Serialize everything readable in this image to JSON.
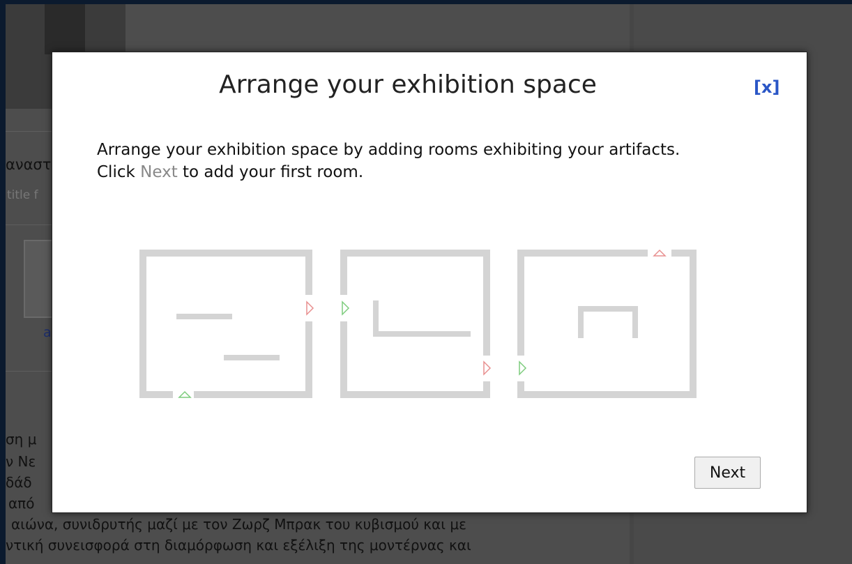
{
  "background": {
    "snippets": [
      "αναστ",
      "title f",
      "a",
      "ση μ",
      "ν Νε",
      "δάδ",
      "από",
      "αιώνα, συνιδρυτής μαζί με τον Ζωρζ Μπρακ του κυβισμού και με",
      "ντική συνεισφορά στη διαμόρφωση και εξέλιξη της μοντέρνας και"
    ]
  },
  "modal": {
    "title": "Arrange your exhibition space",
    "close_label": "[x]",
    "instruction_line1": "Arrange your exhibition space by adding rooms exhibiting your artifacts.",
    "instruction_click": "Click",
    "instruction_next": "Next",
    "instruction_rest": "to add your first room.",
    "next_button": "Next"
  },
  "colors": {
    "wall": "#d4d4d4",
    "entrance": "#7dcc7d",
    "exit": "#e88f8f",
    "close_link": "#2a56c6"
  }
}
